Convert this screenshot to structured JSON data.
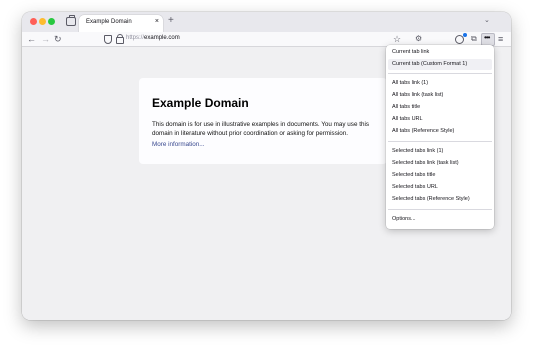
{
  "browser": {
    "tab_title": "Example Domain",
    "tab_close": "×",
    "new_tab": "+",
    "list_tabs": "⌄",
    "url_scheme": "https://",
    "url_host": "example.com",
    "back": "←",
    "forward": "→",
    "reload": "↻",
    "bookmark": "☆",
    "devtools": "⚙",
    "extensions": "⧉",
    "menu": "≡",
    "ext_button": "•••"
  },
  "page": {
    "heading": "Example Domain",
    "description": "This domain is for use in illustrative examples in documents. You may use this domain in literature without prior coordination or asking for permission.",
    "link": "More information..."
  },
  "dropdown": {
    "items": [
      {
        "label": "Current tab link"
      },
      {
        "label": "Current tab (Custom Format 1)"
      },
      {
        "label": "All tabs link (1)"
      },
      {
        "label": "All tabs link (task list)"
      },
      {
        "label": "All tabs title"
      },
      {
        "label": "All tabs URL"
      },
      {
        "label": "All tabs (Reference Style)"
      },
      {
        "label": "Selected tabs link (1)"
      },
      {
        "label": "Selected tabs link (task list)"
      },
      {
        "label": "Selected tabs title"
      },
      {
        "label": "Selected tabs URL"
      },
      {
        "label": "Selected tabs (Reference Style)"
      },
      {
        "label": "Options..."
      }
    ]
  },
  "colors": {
    "link": "#38488f",
    "traffic_red": "#ff5f57",
    "traffic_yellow": "#febc2e",
    "traffic_green": "#28c840"
  }
}
